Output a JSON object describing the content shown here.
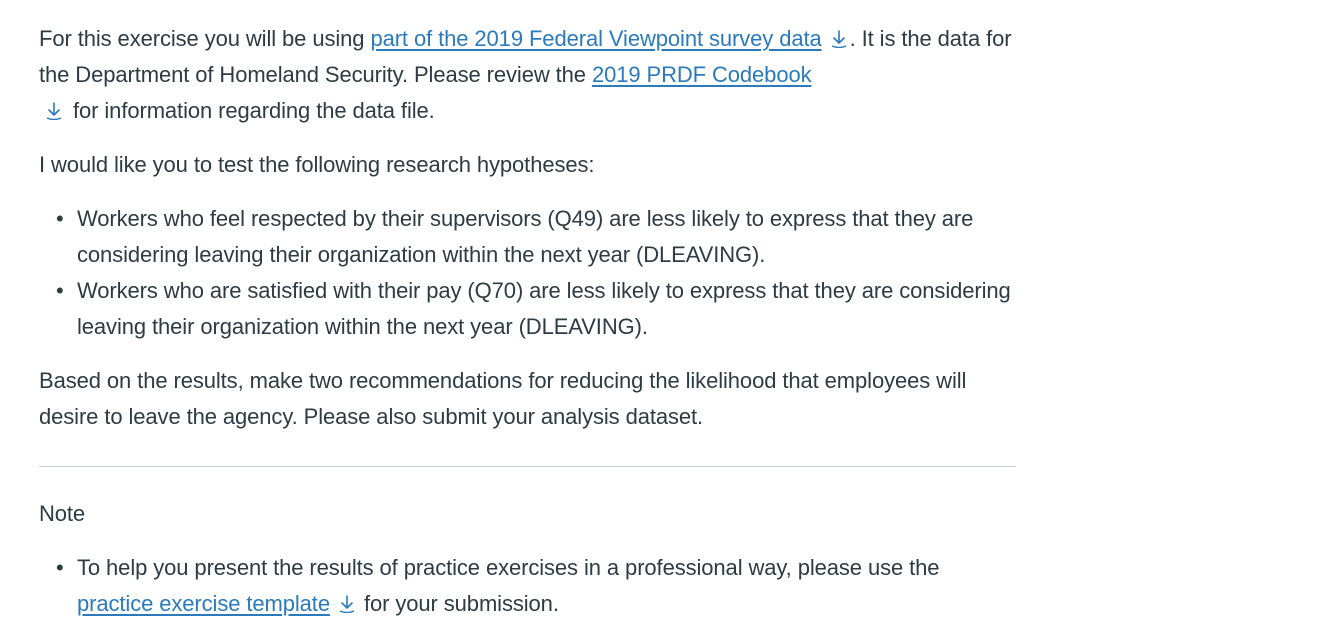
{
  "intro": {
    "text_1": "For this exercise you will be using ",
    "link_survey": "part of the 2019 Federal Viewpoint survey data",
    "text_2": ". It is the data for the Department of Homeland Security.  Please review the ",
    "link_codebook": "2019 PRDF Codebook",
    "text_3": " for information regarding the data file."
  },
  "hypotheses_intro": "I would like you to test the following research hypotheses:",
  "hypotheses": [
    "Workers who feel respected by their supervisors (Q49) are less likely to express that they are considering leaving their organization within the next year (DLEAVING).",
    "Workers who are satisfied with their pay (Q70) are less likely to express that they are considering leaving their organization within the next year (DLEAVING)."
  ],
  "recommendation": "Based on the results, make two recommendations for reducing the likelihood that employees will desire to leave the agency. Please also submit your analysis dataset.",
  "note": {
    "heading": "Note",
    "text_1": "To help you present the results of practice exercises in a professional way, please use the ",
    "link_template": "practice exercise template",
    "text_2": " for your submission."
  },
  "bullet_glyph": "•",
  "colors": {
    "text": "#2d3b45",
    "link": "#2b7abc",
    "rule": "#c7cdd1"
  }
}
